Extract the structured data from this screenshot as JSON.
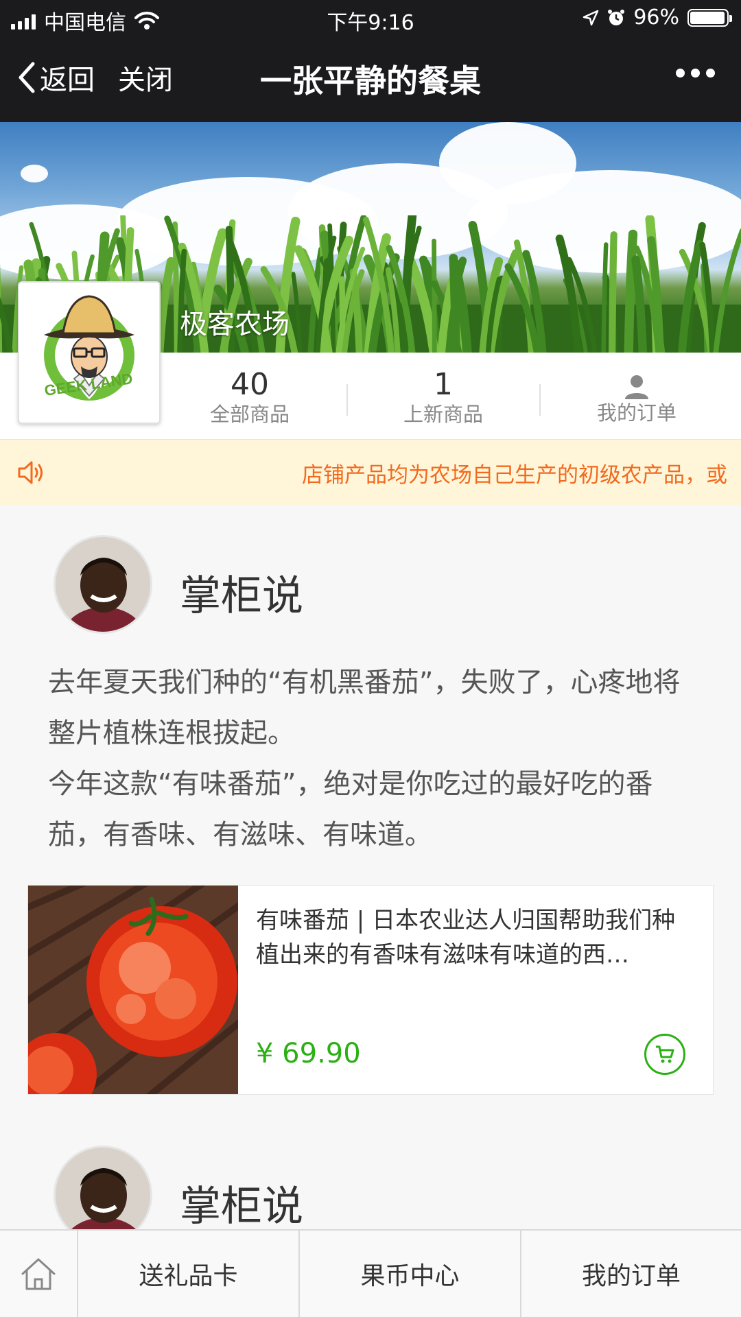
{
  "status_bar": {
    "carrier": "中国电信",
    "time": "下午9:16",
    "battery_percent": "96%",
    "battery_level": 0.96,
    "icons": [
      "signal-icon",
      "wifi-icon",
      "location-icon",
      "alarm-icon",
      "battery-icon"
    ]
  },
  "nav": {
    "back_label": "返回",
    "close_label": "关闭",
    "title": "一张平静的餐桌",
    "more_icon": "more-icon"
  },
  "shop": {
    "name": "极客农场",
    "logo_text": "GEEK LAND",
    "stats": [
      {
        "value": "40",
        "label": "全部商品"
      },
      {
        "value": "1",
        "label": "上新商品"
      },
      {
        "icon": "user-icon",
        "label": "我的订单"
      }
    ]
  },
  "notice": {
    "icon": "speaker-icon",
    "text": "店铺产品均为农场自己生产的初级农产品，或"
  },
  "posts": [
    {
      "author": "掌柜说",
      "paragraphs": [
        "去年夏天我们种的“有机黑番茄”，失败了，心疼地将整片植株连根拔起。",
        "今年这款“有味番茄”，绝对是你吃过的最好吃的番茄，有香味、有滋味、有味道。"
      ],
      "product": {
        "title": "有味番茄 | 日本农业达人归国帮助我们种植出来的有香味有滋味有味道的西…",
        "price": "¥ 69.90",
        "cart_icon": "cart-icon"
      }
    },
    {
      "author": "掌柜说"
    }
  ],
  "tabbar": {
    "home_icon": "home-icon",
    "items": [
      "送礼品卡",
      "果币中心",
      "我的订单"
    ]
  },
  "colors": {
    "nav_bg": "#1b1b1d",
    "accent_green": "#2bb014",
    "notice_bg": "#fff6d9",
    "notice_text": "#f26a1f"
  }
}
